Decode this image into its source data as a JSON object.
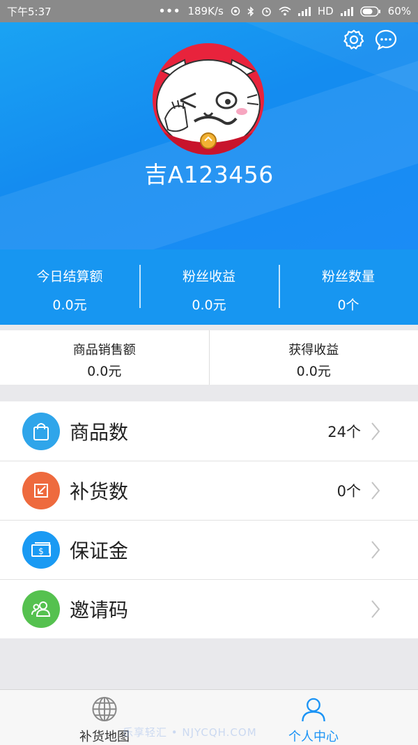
{
  "status_bar": {
    "time": "下午5:37",
    "speed": "189K/s",
    "network": "HD",
    "battery": "60%"
  },
  "profile": {
    "plate_number": "吉A123456"
  },
  "stats": [
    {
      "label": "今日结算额",
      "value": "0.0元"
    },
    {
      "label": "粉丝收益",
      "value": "0.0元"
    },
    {
      "label": "粉丝数量",
      "value": "0个"
    }
  ],
  "sales": [
    {
      "label": "商品销售额",
      "value": "0.0元"
    },
    {
      "label": "获得收益",
      "value": "0.0元"
    }
  ],
  "menu": [
    {
      "label": "商品数",
      "value": "24个",
      "icon": "bag-icon",
      "color": "#2fa5ea"
    },
    {
      "label": "补货数",
      "value": "0个",
      "icon": "restock-icon",
      "color": "#ee6a3e"
    },
    {
      "label": "保证金",
      "value": "",
      "icon": "cash-icon",
      "color": "#1a9af3"
    },
    {
      "label": "邀请码",
      "value": "",
      "icon": "users-icon",
      "color": "#55c14f"
    }
  ],
  "tabs": [
    {
      "label": "补货地图",
      "icon": "globe-icon",
      "active": false
    },
    {
      "label": "个人中心",
      "icon": "person-icon",
      "active": true
    }
  ],
  "watermark": "乐享轻汇 • NJYCQH.COM",
  "colors": {
    "primary": "#1796f1",
    "active_tab": "#1a93f5"
  }
}
